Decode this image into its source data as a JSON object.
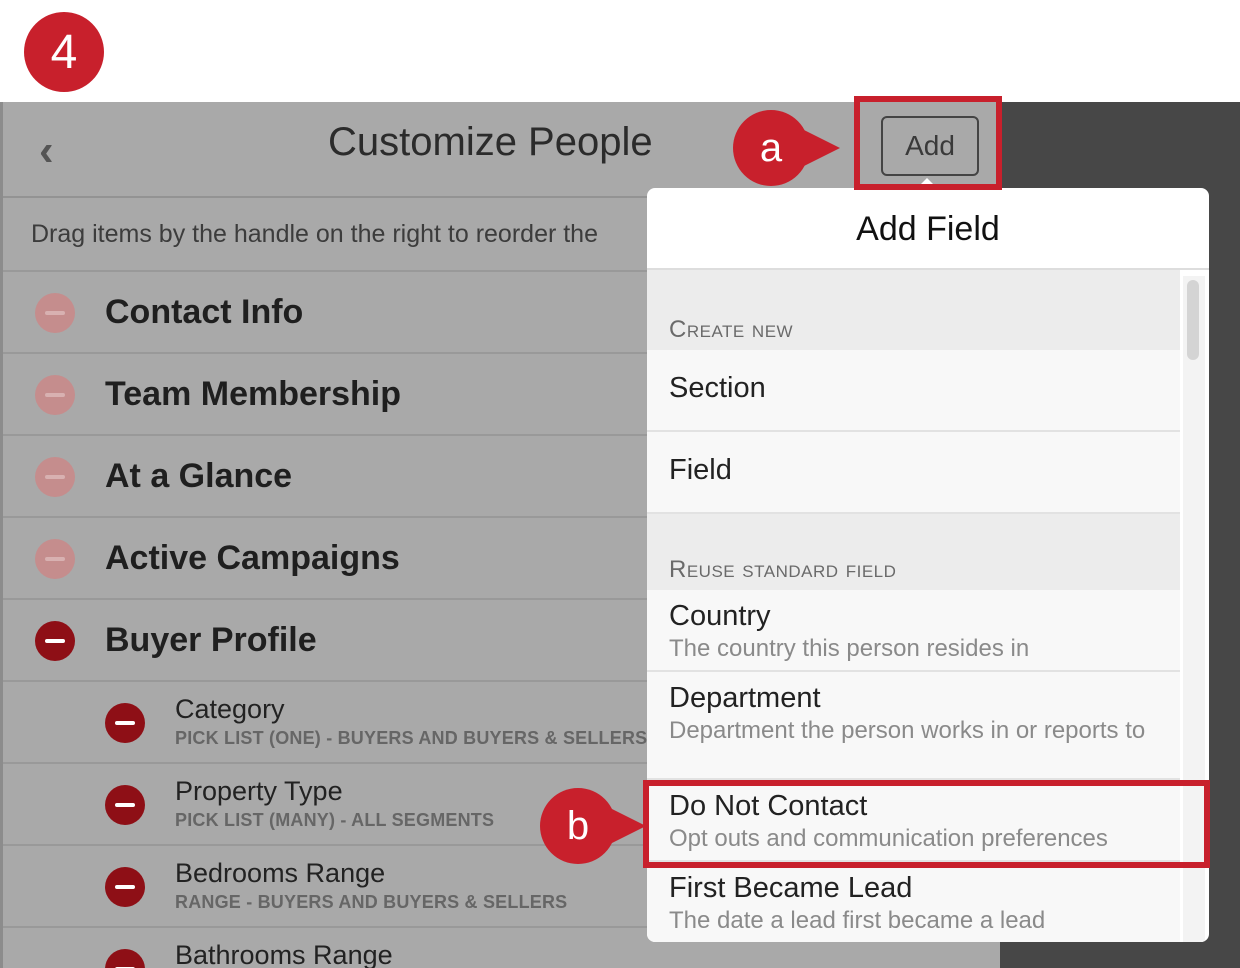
{
  "step_number": "4",
  "callouts": {
    "a": "a",
    "b": "b"
  },
  "colors": {
    "callout_red": "#c8202c",
    "remove_red": "#8e0f16"
  },
  "header": {
    "back_glyph": "‹",
    "title": "Customize People",
    "add_label": "Add"
  },
  "hint": "Drag items by the handle on the right to reorder the",
  "sections": [
    {
      "label": "Contact Info",
      "active": false
    },
    {
      "label": "Team Membership",
      "active": false
    },
    {
      "label": "At a Glance",
      "active": false
    },
    {
      "label": "Active Campaigns",
      "active": false
    },
    {
      "label": "Buyer Profile",
      "active": true
    }
  ],
  "fields": [
    {
      "label": "Category",
      "meta": "PICK LIST (ONE) - BUYERS AND BUYERS & SELLERS"
    },
    {
      "label": "Property Type",
      "meta": "PICK LIST (MANY) - ALL SEGMENTS"
    },
    {
      "label": "Bedrooms Range",
      "meta": "RANGE - BUYERS AND BUYERS & SELLERS"
    },
    {
      "label": "Bathrooms Range",
      "meta": ""
    }
  ],
  "popover": {
    "title": "Add Field",
    "create_new_header": "Create new",
    "create_items": [
      "Section",
      "Field"
    ],
    "reuse_header": "Reuse standard field",
    "reuse_items": [
      {
        "name": "Country",
        "desc": "The country this person resides in"
      },
      {
        "name": "Department",
        "desc": "Department the person works in or reports to"
      },
      {
        "name": "Do Not Contact",
        "desc": "Opt outs and communication preferences"
      },
      {
        "name": "First Became Lead",
        "desc": "The date a lead first became a lead"
      }
    ]
  },
  "icons": [
    "back-chevron-icon",
    "remove-icon",
    "gear-icon",
    "drag-handle-icon"
  ]
}
